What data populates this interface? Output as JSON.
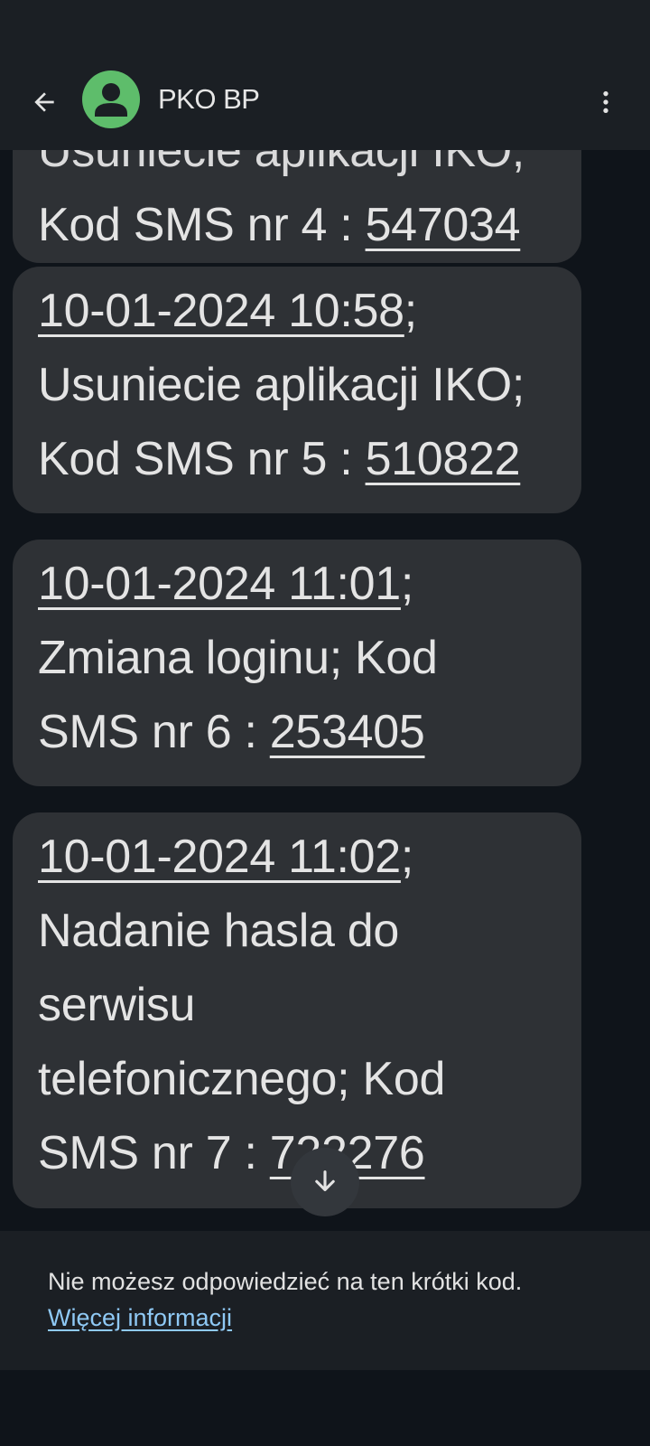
{
  "header": {
    "contact_name": "PKO BP",
    "back_icon": "arrow-back-icon",
    "avatar_icon": "person-icon",
    "more_icon": "more-vert-icon",
    "avatar_color": "#5ebd6b"
  },
  "messages": [
    {
      "partial_line": "Usuniecie aplikacji IKO;",
      "code_prefix": "Kod SMS nr 4 : ",
      "code": "547034"
    },
    {
      "date": "10-01-2024 10:58",
      "line2": "Usuniecie aplikacji IKO;",
      "code_prefix": "Kod SMS nr 5 : ",
      "code": "510822"
    },
    {
      "date": "10-01-2024 11:01",
      "line2": "Zmiana loginu; Kod",
      "code_prefix": "SMS nr 6 : ",
      "code": "253405"
    },
    {
      "date": "10-01-2024 11:02",
      "line2": "Nadanie hasla do",
      "line3": "serwisu",
      "line4": "telefonicznego; Kod",
      "code_prefix": "SMS nr 7 : ",
      "code": "722276"
    }
  ],
  "scroll_button_icon": "arrow-down-icon",
  "reply_panel": {
    "notice": "Nie możesz odpowiedzieć na ten krótki kod.",
    "link": "Więcej informacji"
  }
}
